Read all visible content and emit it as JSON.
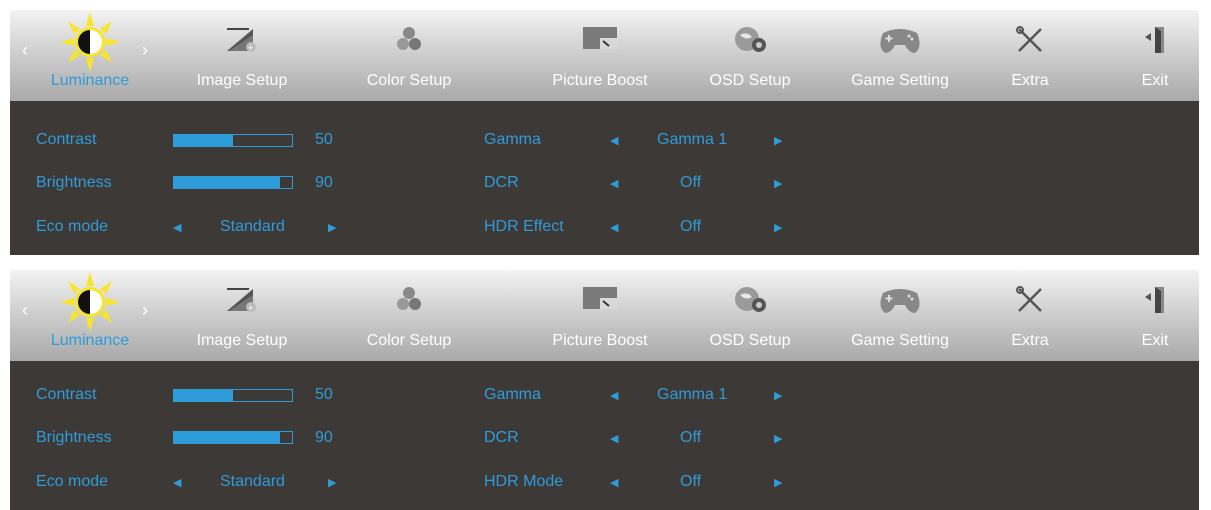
{
  "panels": [
    {
      "tabs": [
        {
          "label": "Luminance",
          "icon": "sun-icon",
          "active": true
        },
        {
          "label": "Image Setup",
          "icon": "image-setup-icon"
        },
        {
          "label": "Color Setup",
          "icon": "color-setup-icon"
        },
        {
          "label": "Picture Boost",
          "icon": "picture-boost-icon"
        },
        {
          "label": "OSD Setup",
          "icon": "osd-setup-icon"
        },
        {
          "label": "Game Setting",
          "icon": "gamepad-icon"
        },
        {
          "label": "Extra",
          "icon": "tools-icon"
        },
        {
          "label": "Exit",
          "icon": "exit-door-icon"
        }
      ],
      "contrast": {
        "label": "Contrast",
        "value": "50",
        "fill": 0.5
      },
      "brightness": {
        "label": "Brightness",
        "value": "90",
        "fill": 0.9
      },
      "eco": {
        "label": "Eco mode",
        "value": "Standard"
      },
      "gamma": {
        "label": "Gamma",
        "value": "Gamma 1"
      },
      "dcr": {
        "label": "DCR",
        "value": "Off"
      },
      "hdr": {
        "label": "HDR Effect",
        "value": "Off"
      }
    },
    {
      "tabs": [
        {
          "label": "Luminance",
          "icon": "sun-icon",
          "active": true
        },
        {
          "label": "Image Setup",
          "icon": "image-setup-icon"
        },
        {
          "label": "Color Setup",
          "icon": "color-setup-icon"
        },
        {
          "label": "Picture Boost",
          "icon": "picture-boost-icon"
        },
        {
          "label": "OSD Setup",
          "icon": "osd-setup-icon"
        },
        {
          "label": "Game Setting",
          "icon": "gamepad-icon"
        },
        {
          "label": "Extra",
          "icon": "tools-icon"
        },
        {
          "label": "Exit",
          "icon": "exit-door-icon"
        }
      ],
      "contrast": {
        "label": "Contrast",
        "value": "50",
        "fill": 0.5
      },
      "brightness": {
        "label": "Brightness",
        "value": "90",
        "fill": 0.9
      },
      "eco": {
        "label": "Eco mode",
        "value": "Standard"
      },
      "gamma": {
        "label": "Gamma",
        "value": "Gamma 1"
      },
      "dcr": {
        "label": "DCR",
        "value": "Off"
      },
      "hdr": {
        "label": "HDR Mode",
        "value": "Off"
      }
    }
  ],
  "colors": {
    "accent": "#2e9cd9",
    "panel_bg": "#3d3937",
    "sun": "#f7e52b"
  }
}
